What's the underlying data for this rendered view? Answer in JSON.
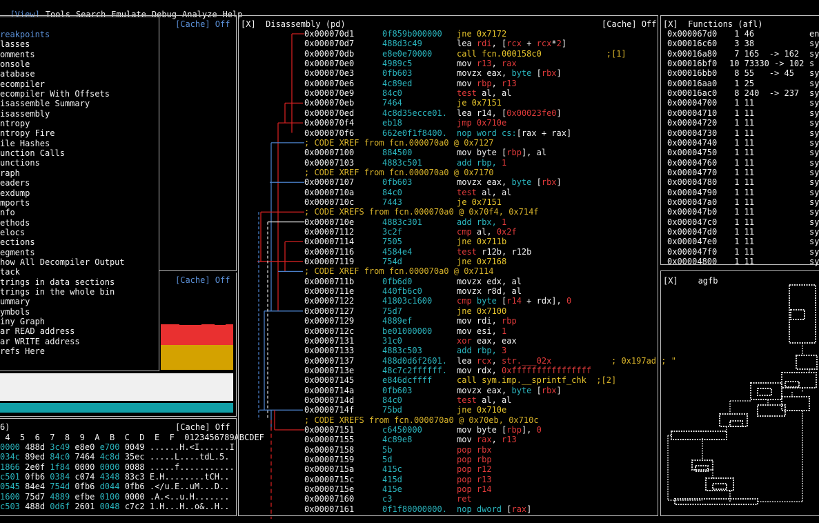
{
  "menubar": {
    "items": [
      "[View]",
      "Tools",
      "Search",
      "Emulate",
      "Debug",
      "Analyze",
      "Help"
    ]
  },
  "left_top": {
    "cache": "[Cache] Off"
  },
  "view_menu": {
    "items": [
      "reakpoints",
      "lasses",
      "omments",
      "onsole",
      "atabase",
      "ecompiler",
      "ecompiler With Offsets",
      "isassemble Summary",
      "isassembly",
      "ntropy",
      "ntropy Fire",
      "ile Hashes",
      "unction Calls",
      "unctions",
      "raph",
      "eaders",
      "exdump",
      "mports",
      "nfo",
      "ethods",
      "elocs",
      "ections",
      "egments",
      "how All Decompiler Output",
      "tack",
      "trings in data sections",
      "trings in the whole bin",
      "ummary",
      "ymbols",
      "iny Graph",
      "ar READ address",
      "ar WRITE address",
      "refs Here"
    ]
  },
  "left_mid": {
    "cache": "[Cache] Off"
  },
  "hexdump": {
    "title": "6)",
    "cache": "[Cache] Off",
    "header": " 4  5  6  7  8  9  A  B  C  D  E  F  0123456789ABCDEF",
    "rows": [
      [
        "0000",
        "488d",
        "3c49",
        "e8e0",
        "e700",
        "0049",
        "......H.<I......I"
      ],
      [
        "034c",
        "89ed",
        "84c0",
        "7464",
        "4c8d",
        "35ec",
        ".....L....tdL.5."
      ],
      [
        "1866",
        "2e0f",
        "1f84",
        "0000",
        "0000",
        "0088",
        ".....f..........."
      ],
      [
        "c501",
        "0fb6",
        "0384",
        "c074",
        "4348",
        "83c3",
        "E.H........tCH.."
      ],
      [
        "0545",
        "84e4",
        "754d",
        "0fb6",
        "d044",
        "0fb6",
        ".</u.E..uM...D.."
      ],
      [
        "1600",
        "75d7",
        "4889",
        "efbe",
        "0100",
        "0000",
        ".A.<..u.H......."
      ],
      [
        "c503",
        "488d",
        "0d6f",
        "2601",
        "0048",
        "c7c2",
        "1.H...H..o&..H.."
      ]
    ]
  },
  "disasm": {
    "title": "[X]  Disassembly (pd)",
    "cache": "[Cache] Off",
    "lines": [
      {
        "a": "0x000070d1",
        "b": "0f859b000000",
        "i": [
          [
            "y",
            "jne 0x7172"
          ]
        ]
      },
      {
        "a": "0x000070d7",
        "b": "488d3c49",
        "i": [
          [
            "g",
            "lea "
          ],
          [
            "r",
            "rdi"
          ],
          [
            "g",
            ", ["
          ],
          [
            "r",
            "rcx"
          ],
          [
            "g",
            " + "
          ],
          [
            "r",
            "rcx"
          ],
          [
            "g",
            "*"
          ],
          [
            "r",
            "2"
          ],
          [
            "g",
            "]"
          ]
        ]
      },
      {
        "a": "0x000070db",
        "b": "e8e0e70000",
        "i": [
          [
            "y",
            "call fcn.000158c0"
          ],
          [
            "cm",
            "             ;[1]"
          ]
        ]
      },
      {
        "a": "0x000070e0",
        "b": "4989c5",
        "i": [
          [
            "g",
            "mov "
          ],
          [
            "r",
            "r13"
          ],
          [
            "g",
            ", "
          ],
          [
            "r",
            "rax"
          ]
        ]
      },
      {
        "a": "0x000070e3",
        "b": "0fb603",
        "i": [
          [
            "g",
            "movzx "
          ],
          [
            "g",
            "eax, "
          ],
          [
            "c",
            "byte"
          ],
          [
            "g",
            " ["
          ],
          [
            "r",
            "rbx"
          ],
          [
            "g",
            "]"
          ]
        ]
      },
      {
        "a": "0x000070e6",
        "b": "4c89ed",
        "i": [
          [
            "g",
            "mov "
          ],
          [
            "r",
            "rbp"
          ],
          [
            "g",
            ", "
          ],
          [
            "r",
            "r13"
          ]
        ]
      },
      {
        "a": "0x000070e9",
        "b": "84c0",
        "i": [
          [
            "r",
            "test "
          ],
          [
            "g",
            "al, al"
          ]
        ]
      },
      {
        "a": "0x000070eb",
        "b": "7464",
        "i": [
          [
            "y",
            "je 0x7151"
          ]
        ]
      },
      {
        "a": "0x000070ed",
        "b": "4c8d35ecce01.",
        "i": [
          [
            "g",
            "lea "
          ],
          [
            "g",
            "r14, ["
          ],
          [
            "r",
            "0x00023fe0"
          ],
          [
            "g",
            "]"
          ]
        ]
      },
      {
        "a": "0x000070f4",
        "b": "eb18",
        "i": [
          [
            "r",
            "jmp 0x710e"
          ]
        ]
      },
      {
        "a": "0x000070f6",
        "b": "662e0f1f8400.",
        "i": [
          [
            "c",
            "nop word cs:"
          ],
          [
            "g",
            "[rax + rax]"
          ]
        ]
      },
      {
        "cm": "; CODE XREF from fcn.000070a0 @ 0x7127"
      },
      {
        "a": "0x00007100",
        "b": "884500",
        "i": [
          [
            "g",
            "mov byte ["
          ],
          [
            "r",
            "rbp"
          ],
          [
            "g",
            "], al"
          ]
        ]
      },
      {
        "a": "0x00007103",
        "b": "4883c501",
        "i": [
          [
            "c",
            "add rbp, "
          ],
          [
            "r",
            "1"
          ]
        ]
      },
      {
        "cm": "; CODE XREF from fcn.000070a0 @ 0x7170"
      },
      {
        "a": "0x00007107",
        "b": "0fb603",
        "i": [
          [
            "g",
            "movzx eax, "
          ],
          [
            "c",
            "byte"
          ],
          [
            "g",
            " ["
          ],
          [
            "r",
            "rbx"
          ],
          [
            "g",
            "]"
          ]
        ]
      },
      {
        "a": "0x0000710a",
        "b": "84c0",
        "i": [
          [
            "r",
            "test "
          ],
          [
            "g",
            "al, al"
          ]
        ]
      },
      {
        "a": "0x0000710c",
        "b": "7443",
        "i": [
          [
            "y",
            "je 0x7151"
          ]
        ]
      },
      {
        "cm": "; CODE XREFS from fcn.000070a0 @ 0x70f4, 0x714f"
      },
      {
        "a": "0x0000710e",
        "b": "4883c301",
        "i": [
          [
            "c",
            "add rbx, "
          ],
          [
            "r",
            "1"
          ]
        ]
      },
      {
        "a": "0x00007112",
        "b": "3c2f",
        "i": [
          [
            "r",
            "cmp "
          ],
          [
            "g",
            "al, "
          ],
          [
            "r",
            "0x2f"
          ]
        ]
      },
      {
        "a": "0x00007114",
        "b": "7505",
        "i": [
          [
            "y",
            "jne 0x711b"
          ]
        ]
      },
      {
        "a": "0x00007116",
        "b": "4584e4",
        "i": [
          [
            "r",
            "test "
          ],
          [
            "g",
            "r12b, r12b"
          ]
        ]
      },
      {
        "a": "0x00007119",
        "b": "754d",
        "i": [
          [
            "y",
            "jne 0x7168"
          ]
        ]
      },
      {
        "cm": "; CODE XREF from fcn.000070a0 @ 0x7114"
      },
      {
        "a": "0x0000711b",
        "b": "0fb6d0",
        "i": [
          [
            "g",
            "movzx edx, al"
          ]
        ]
      },
      {
        "a": "0x0000711e",
        "b": "440fb6c0",
        "i": [
          [
            "g",
            "movzx r8d, al"
          ]
        ]
      },
      {
        "a": "0x00007122",
        "b": "41803c1600",
        "i": [
          [
            "r",
            "cmp "
          ],
          [
            "c",
            "byte"
          ],
          [
            "g",
            " ["
          ],
          [
            "r",
            "r14"
          ],
          [
            "g",
            " + rdx], "
          ],
          [
            "r",
            "0"
          ]
        ]
      },
      {
        "a": "0x00007127",
        "b": "75d7",
        "i": [
          [
            "y",
            "jne 0x7100"
          ]
        ]
      },
      {
        "a": "0x00007129",
        "b": "4889ef",
        "i": [
          [
            "g",
            "mov rdi, "
          ],
          [
            "r",
            "rbp"
          ]
        ]
      },
      {
        "a": "0x0000712c",
        "b": "be01000000",
        "i": [
          [
            "g",
            "mov esi, "
          ],
          [
            "r",
            "1"
          ]
        ]
      },
      {
        "a": "0x00007131",
        "b": "31c0",
        "i": [
          [
            "r",
            "xor "
          ],
          [
            "g",
            "eax, eax"
          ]
        ]
      },
      {
        "a": "0x00007133",
        "b": "4883c503",
        "i": [
          [
            "c",
            "add rbp, "
          ],
          [
            "r",
            "3"
          ]
        ]
      },
      {
        "a": "0x00007137",
        "b": "488d0d6f2601.",
        "i": [
          [
            "g",
            "lea "
          ],
          [
            "r",
            "rcx"
          ],
          [
            "g",
            ", "
          ],
          [
            "r",
            "str.___02x"
          ],
          [
            "cm",
            "            ; 0x197ad ; \""
          ]
        ]
      },
      {
        "a": "0x0000713e",
        "b": "48c7c2ffffff.",
        "i": [
          [
            "g",
            "mov rdx, "
          ],
          [
            "r",
            "0xffffffffffffffff"
          ]
        ]
      },
      {
        "a": "0x00007145",
        "b": "e846dcffff",
        "i": [
          [
            "y",
            "call sym.imp.__sprintf_chk"
          ],
          [
            "cm",
            "  ;[2]"
          ]
        ]
      },
      {
        "a": "0x0000714a",
        "b": "0fb603",
        "i": [
          [
            "g",
            "movzx eax, "
          ],
          [
            "c",
            "byte"
          ],
          [
            "g",
            " ["
          ],
          [
            "r",
            "rbx"
          ],
          [
            "g",
            "]"
          ]
        ]
      },
      {
        "a": "0x0000714d",
        "b": "84c0",
        "i": [
          [
            "r",
            "test "
          ],
          [
            "g",
            "al, al"
          ]
        ]
      },
      {
        "a": "0x0000714f",
        "b": "75bd",
        "i": [
          [
            "y",
            "jne 0x710e"
          ]
        ]
      },
      {
        "cm": "; CODE XREFS from fcn.000070a0 @ 0x70eb, 0x710c"
      },
      {
        "a": "0x00007151",
        "b": "c6450000",
        "i": [
          [
            "g",
            "mov byte ["
          ],
          [
            "r",
            "rbp"
          ],
          [
            "g",
            "], "
          ],
          [
            "r",
            "0"
          ]
        ]
      },
      {
        "a": "0x00007155",
        "b": "4c89e8",
        "i": [
          [
            "g",
            "mov "
          ],
          [
            "r",
            "rax"
          ],
          [
            "g",
            ", "
          ],
          [
            "r",
            "r13"
          ]
        ]
      },
      {
        "a": "0x00007158",
        "b": "5b",
        "i": [
          [
            "r",
            "pop "
          ],
          [
            "r",
            "rbx"
          ]
        ]
      },
      {
        "a": "0x00007159",
        "b": "5d",
        "i": [
          [
            "r",
            "pop "
          ],
          [
            "r",
            "rbp"
          ]
        ]
      },
      {
        "a": "0x0000715a",
        "b": "415c",
        "i": [
          [
            "r",
            "pop "
          ],
          [
            "r",
            "r12"
          ]
        ]
      },
      {
        "a": "0x0000715c",
        "b": "415d",
        "i": [
          [
            "r",
            "pop "
          ],
          [
            "r",
            "r13"
          ]
        ]
      },
      {
        "a": "0x0000715e",
        "b": "415e",
        "i": [
          [
            "r",
            "pop "
          ],
          [
            "r",
            "r14"
          ]
        ]
      },
      {
        "a": "0x00007160",
        "b": "c3",
        "i": [
          [
            "r",
            "ret"
          ]
        ]
      },
      {
        "a": "0x00007161",
        "b": "0f1f80000000.",
        "i": [
          [
            "c",
            "nop dword "
          ],
          [
            "g",
            "["
          ],
          [
            "r",
            "rax"
          ],
          [
            "g",
            "]"
          ]
        ]
      }
    ]
  },
  "functions": {
    "title": "[X]  Functions (afl)",
    "rows": [
      [
        "0x000067d0",
        " 1 46",
        "en"
      ],
      [
        "0x00016c60",
        " 3 38",
        "sy"
      ],
      [
        "0x00016a80",
        " 7 165  -> 162",
        "sy"
      ],
      [
        "0x00016bf0",
        "10 73330 -> 102",
        "s"
      ],
      [
        "0x00016bb0",
        " 8 55   -> 45",
        "sy"
      ],
      [
        "0x00016aa0",
        " 1 25",
        "sy"
      ],
      [
        "0x00016ac0",
        " 8 240  -> 237",
        "sy"
      ],
      [
        "0x00004700",
        " 1 11",
        "sy"
      ],
      [
        "0x00004710",
        " 1 11",
        "sy"
      ],
      [
        "0x00004720",
        " 1 11",
        "sy"
      ],
      [
        "0x00004730",
        " 1 11",
        "sy"
      ],
      [
        "0x00004740",
        " 1 11",
        "sy"
      ],
      [
        "0x00004750",
        " 1 11",
        "sy"
      ],
      [
        "0x00004760",
        " 1 11",
        "sy"
      ],
      [
        "0x00004770",
        " 1 11",
        "sy"
      ],
      [
        "0x00004780",
        " 1 11",
        "sy"
      ],
      [
        "0x00004790",
        " 1 11",
        "sy"
      ],
      [
        "0x000047a0",
        " 1 11",
        "sy"
      ],
      [
        "0x000047b0",
        " 1 11",
        "sy"
      ],
      [
        "0x000047c0",
        " 1 11",
        "sy"
      ],
      [
        "0x000047d0",
        " 1 11",
        "sy"
      ],
      [
        "0x000047e0",
        " 1 11",
        "sy"
      ],
      [
        "0x000047f0",
        " 1 11",
        "sy"
      ],
      [
        "0x00004800",
        " 1 11",
        "sy"
      ]
    ]
  },
  "graph": {
    "title": "[X]    agfb"
  },
  "colors": {
    "accent": "#5a8fd6",
    "red": "#e93030",
    "yellow": "#d4a200",
    "white": "#f0f0f0",
    "teal": "#12a0a8"
  }
}
